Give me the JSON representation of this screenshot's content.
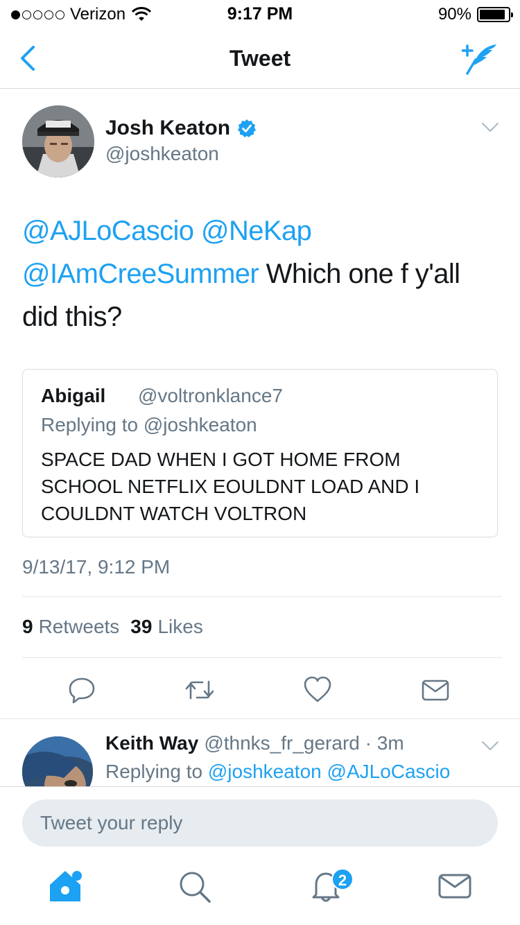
{
  "status_bar": {
    "carrier": "Verizon",
    "time": "9:17 PM",
    "battery": "90%",
    "battery_level": 0.9
  },
  "nav": {
    "title": "Tweet",
    "back_icon": "chevron-left-icon",
    "compose_icon": "compose-tweet-icon"
  },
  "tweet": {
    "author_name": "Josh Keaton",
    "author_handle": "@joshkeaton",
    "verified": true,
    "mention1": "@AJLoCascio",
    "mention2": "@NeKap",
    "mention3": "@IAmCreeSummer",
    "text_tail": " Which one f y'all did this?",
    "timestamp": "9/13/17, 9:12 PM",
    "retweet_count": "9",
    "retweet_label": "Retweets",
    "like_count": "39",
    "like_label": "Likes"
  },
  "quote": {
    "name": "Abigail",
    "handle": "@voltronklance7",
    "replying_to": "Replying to @joshkeaton",
    "text": "SPACE DAD WHEN I GOT HOME FROM SCHOOL NETFLIX EOULDNT LOAD AND I COULDNT WATCH VOLTRON"
  },
  "reply": {
    "name": "Keith Way",
    "handle": "@thnks_fr_gerard",
    "separator": "·",
    "time": "3m",
    "replying_label": "Replying to",
    "replying_mention1": "@joshkeaton",
    "replying_mention2": "@AJLoCascio"
  },
  "composer": {
    "placeholder": "Tweet your reply"
  },
  "tabbar": {
    "notifications_badge": "2"
  },
  "colors": {
    "accent": "#1da1f2",
    "secondary_text": "#657786",
    "primary_text": "#14171a"
  }
}
